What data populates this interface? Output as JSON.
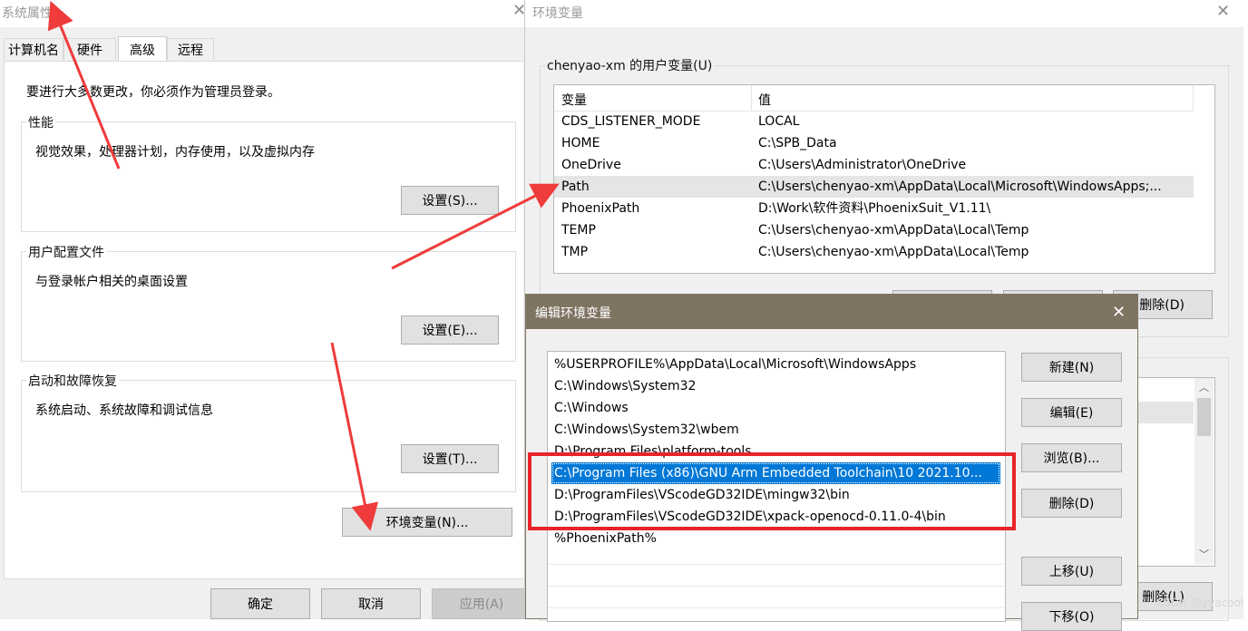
{
  "sysprops": {
    "title": "系统属性",
    "tabs": [
      "计算机名",
      "硬件",
      "高级",
      "远程"
    ],
    "admin_note": "要进行大多数更改，你必须作为管理员登录。",
    "performance": {
      "label": "性能",
      "desc": "视觉效果，处理器计划，内存使用，以及虚拟内存",
      "button": "设置(S)..."
    },
    "profiles": {
      "label": "用户配置文件",
      "desc": "与登录帐户相关的桌面设置",
      "button": "设置(E)..."
    },
    "startup": {
      "label": "启动和故障恢复",
      "desc": "系统启动、系统故障和调试信息",
      "button": "设置(T)..."
    },
    "env_button": "环境变量(N)...",
    "ok": "确定",
    "cancel": "取消",
    "apply": "应用(A)"
  },
  "envvars": {
    "title": "环境变量",
    "user_group_label": "chenyao-xm 的用户变量(U)",
    "columns": [
      "变量",
      "值"
    ],
    "rows": [
      {
        "name": "CDS_LISTENER_MODE",
        "value": "LOCAL"
      },
      {
        "name": "HOME",
        "value": "C:\\SPB_Data"
      },
      {
        "name": "OneDrive",
        "value": "C:\\Users\\Administrator\\OneDrive"
      },
      {
        "name": "Path",
        "value": "C:\\Users\\chenyao-xm\\AppData\\Local\\Microsoft\\WindowsApps;..."
      },
      {
        "name": "PhoenixPath",
        "value": "D:\\Work\\软件资料\\PhoenixSuit_V1.11\\"
      },
      {
        "name": "TEMP",
        "value": "C:\\Users\\chenyao-xm\\AppData\\Local\\Temp"
      },
      {
        "name": "TMP",
        "value": "C:\\Users\\chenyao-xm\\AppData\\Local\\Temp"
      }
    ],
    "user_delete_button": "删除(D)",
    "sys_delete_button": "删除(L)"
  },
  "editenv": {
    "title": "编辑环境变量",
    "items": [
      "%USERPROFILE%\\AppData\\Local\\Microsoft\\WindowsApps",
      "C:\\Windows\\System32",
      "C:\\Windows",
      "C:\\Windows\\System32\\wbem",
      "D:\\Program Files\\platform-tools",
      "C:\\Program Files (x86)\\GNU Arm Embedded Toolchain\\10 2021.10...",
      "D:\\ProgramFiles\\VScodeGD32IDE\\mingw32\\bin",
      "D:\\ProgramFiles\\VScodeGD32IDE\\xpack-openocd-0.11.0-4\\bin",
      "%PhoenixPath%"
    ],
    "buttons": {
      "new": "新建(N)",
      "edit": "编辑(E)",
      "browse": "浏览(B)...",
      "delete": "删除(D)",
      "up": "上移(U)",
      "down": "下移(O)"
    }
  },
  "watermark": "CSDN @yyacool",
  "colors": {
    "highlight_box": "#e8232a",
    "arrow": "#ef3b3b",
    "dialog_title_bg": "#7f7362",
    "selection": "#0078d7"
  }
}
